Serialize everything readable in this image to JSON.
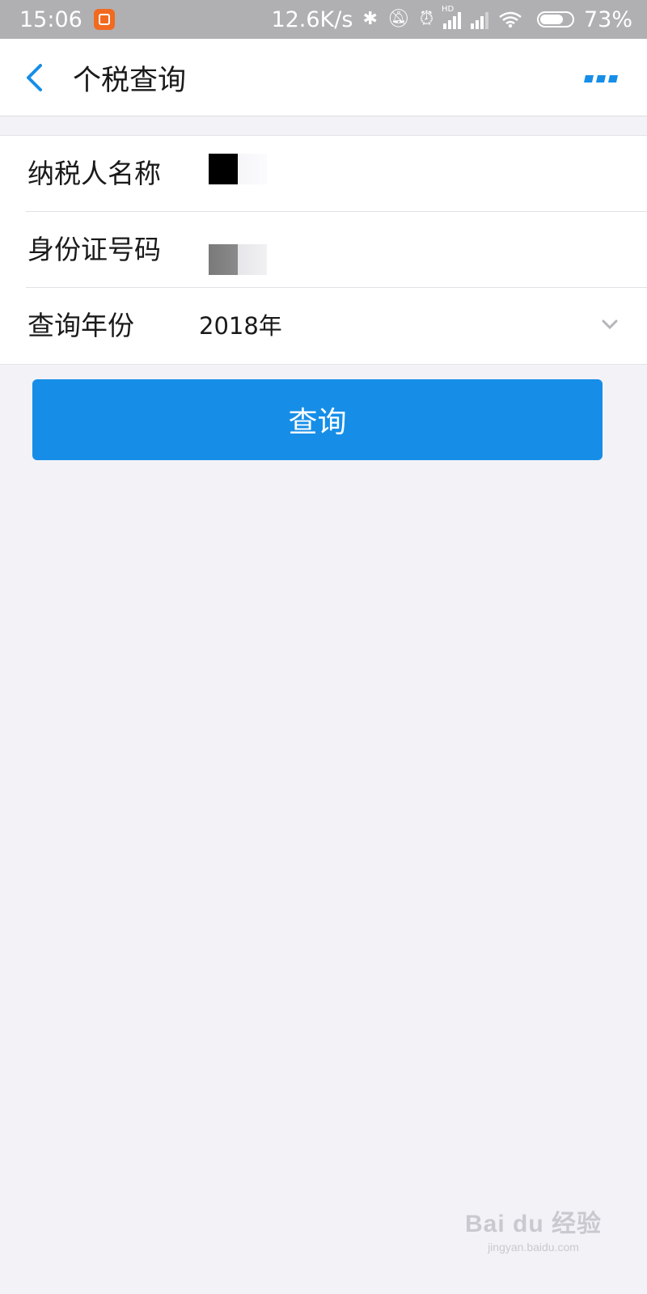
{
  "status_bar": {
    "time": "15:06",
    "net_speed": "12.6K/s",
    "signal_label": "HD",
    "battery_percent": "73%",
    "battery_level": 0.73
  },
  "header": {
    "title": "个税查询",
    "accent_color": "#168ee8"
  },
  "form": {
    "taxpayer_name_label": "纳税人名称",
    "id_number_label": "身份证号码",
    "year_label": "查询年份",
    "year_value": "2018年"
  },
  "query_button": {
    "label": "查询",
    "color": "#168ee8"
  },
  "watermark": {
    "brand": "Bai du 经验",
    "url": "jingyan.baidu.com"
  },
  "icons": [
    "back-arrow-icon",
    "more-icon",
    "chevron-down-icon",
    "bluetooth-icon",
    "mute-icon",
    "alarm-icon",
    "signal-icon",
    "wifi-icon",
    "battery-icon"
  ]
}
